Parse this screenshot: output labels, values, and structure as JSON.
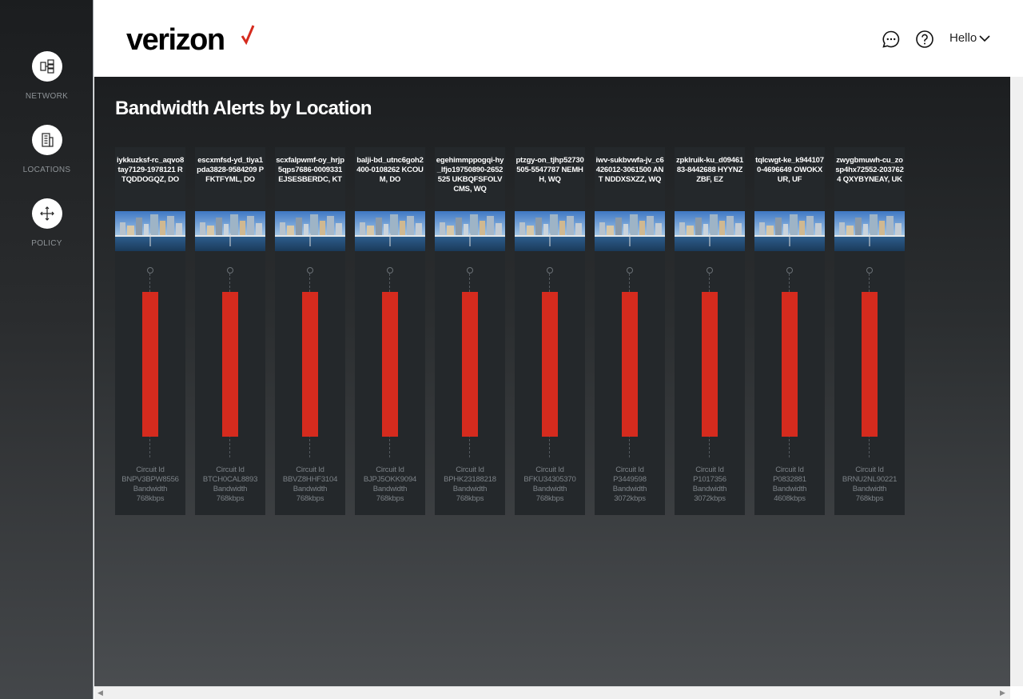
{
  "nav": {
    "items": [
      {
        "label": "NETWORK",
        "icon": "network-icon"
      },
      {
        "label": "LOCATIONS",
        "icon": "building-icon"
      },
      {
        "label": "POLICY",
        "icon": "move-arrows-icon"
      }
    ]
  },
  "header": {
    "logo_text": "verizon",
    "logo_accent_color": "#d52b1e",
    "user_menu_label": "Hello"
  },
  "main": {
    "title": "Bandwidth Alerts by Location",
    "bar_color": "#d52b1e",
    "circuit_id_label": "Circuit Id",
    "bandwidth_label": "Bandwidth",
    "locations": [
      {
        "name": "iykkuzksf-rc_aqvo8tay7129-1978121 RTQDDOGQZ, DO",
        "circuit_id": "BNPV3BPW8556",
        "bandwidth": "768kbps"
      },
      {
        "name": "escxmfsd-yd_tiya1pda3828-9584209 PFKTFYML, DO",
        "circuit_id": "BTCH0CAL8893",
        "bandwidth": "768kbps"
      },
      {
        "name": "scxfalpwmf-oy_hrjp5qps7686-0009331 EJSESBERDC, KT",
        "circuit_id": "BBVZ8HHF3104",
        "bandwidth": "768kbps"
      },
      {
        "name": "balji-bd_utnc6goh2400-0108262 KCOUM, DO",
        "circuit_id": "BJPJ5OKK9094",
        "bandwidth": "768kbps"
      },
      {
        "name": "egehimmppogqi-hy_lfjo19750890-2652525 UKBQFSFOLVCMS, WQ",
        "circuit_id": "BPHK23188218",
        "bandwidth": "768kbps"
      },
      {
        "name": "ptzgy-on_tjhp52730505-5547787 NEMHH, WQ",
        "circuit_id": "BFKU34305370",
        "bandwidth": "768kbps"
      },
      {
        "name": "iwv-sukbvwfa-jv_c6426012-3061500 ANT NDDXSXZZ, WQ",
        "circuit_id": "P3449598",
        "bandwidth": "3072kbps"
      },
      {
        "name": "zpklruik-ku_d0946183-8442688 HYYNZZBF, EZ",
        "circuit_id": "P1017356",
        "bandwidth": "3072kbps"
      },
      {
        "name": "tqlcwgt-ke_k9441070-4696649 OWOKXUR, UF",
        "circuit_id": "P0832881",
        "bandwidth": "4608kbps"
      },
      {
        "name": "zwygbmuwh-cu_zosp4hx72552-2037624 QXYBYNEAY, UK",
        "circuit_id": "BRNU2NL90221",
        "bandwidth": "768kbps"
      }
    ]
  }
}
